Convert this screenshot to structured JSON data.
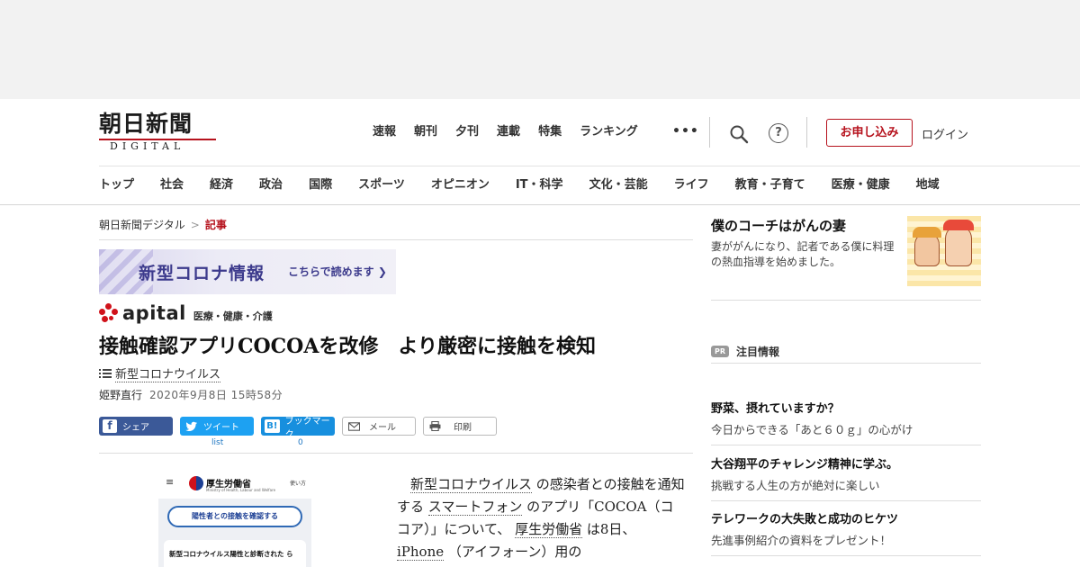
{
  "logo": {
    "main": "朝日新聞",
    "sub": "DIGITAL"
  },
  "top_nav": [
    "速報",
    "朝刊",
    "夕刊",
    "連載",
    "特集",
    "ランキング"
  ],
  "more_label": "•••",
  "help_label": "?",
  "subscribe_label": "お申し込み",
  "login_label": "ログイン",
  "category_nav": [
    "トップ",
    "社会",
    "経済",
    "政治",
    "国際",
    "スポーツ",
    "オピニオン",
    "IT・科学",
    "文化・芸能",
    "ライフ",
    "教育・子育て",
    "医療・健康",
    "地域"
  ],
  "breadcrumb": {
    "home": "朝日新聞デジタル",
    "sep": ">",
    "current": "記事"
  },
  "corona_banner": {
    "title": "新型コロナ情報",
    "link": "こちらで読めます ❯"
  },
  "apital": {
    "word": "apital",
    "tag": "医療・健康・介護"
  },
  "article": {
    "headline": "接触確認アプリCOCOAを改修　より厳密に接触を検知",
    "topic": "新型コロナウイルス",
    "author": "姫野直行",
    "date": "2020年9月8日 15時58分",
    "body": [
      {
        "t": "　",
        "u": false
      },
      {
        "t": "新型コロナウイルス",
        "u": true
      },
      {
        "t": " の感染者との接触を通知する ",
        "u": false
      },
      {
        "t": "スマートフォン",
        "u": true
      },
      {
        "t": " のアプリ「COCOA（ココア）」について、 ",
        "u": false
      },
      {
        "t": "厚生労働省",
        "u": true
      },
      {
        "t": " は8日、 ",
        "u": false
      },
      {
        "t": "iPhone",
        "u": true
      },
      {
        "t": " （アイフォーン）用の",
        "u": false
      }
    ]
  },
  "share": {
    "facebook": "シェア",
    "twitter": "ツイート",
    "twitter_count": "list",
    "hatena": "ブックマーク",
    "hatena_icon": "B!",
    "hatena_count": "0",
    "mail": "メール",
    "print": "印刷"
  },
  "phone_image": {
    "menu": "≡",
    "ministry": "厚生労働省",
    "ministry_en": "Ministry of Health, Labour and Welfare",
    "howto": "使い方",
    "button": "陽性者との接触を確認する",
    "card": "新型コロナウイルス陽性と診断された ら"
  },
  "sidebar": {
    "promo": {
      "title": "僕のコーチはがんの妻",
      "desc": "妻ががんになり、記者である僕に料理の熱血指導を始めました。"
    },
    "pr_badge": "PR",
    "pr_label": "注目情報",
    "pr_items": [
      {
        "title": "野菜、摂れていますか？",
        "sub": "今日からできる「あと６０ｇ」の心がけ"
      },
      {
        "title": "大谷翔平のチャレンジ精神に学ぶ。",
        "sub": "挑戦する人生の方が絶対に楽しい"
      },
      {
        "title": "テレワークの大失敗と成功のヒケツ",
        "sub": "先進事例紹介の資料をプレゼント！"
      }
    ]
  },
  "colors": {
    "brand_red": "#b6121d",
    "facebook": "#3b5998",
    "twitter": "#1da1f2",
    "hatena": "#178fde"
  }
}
